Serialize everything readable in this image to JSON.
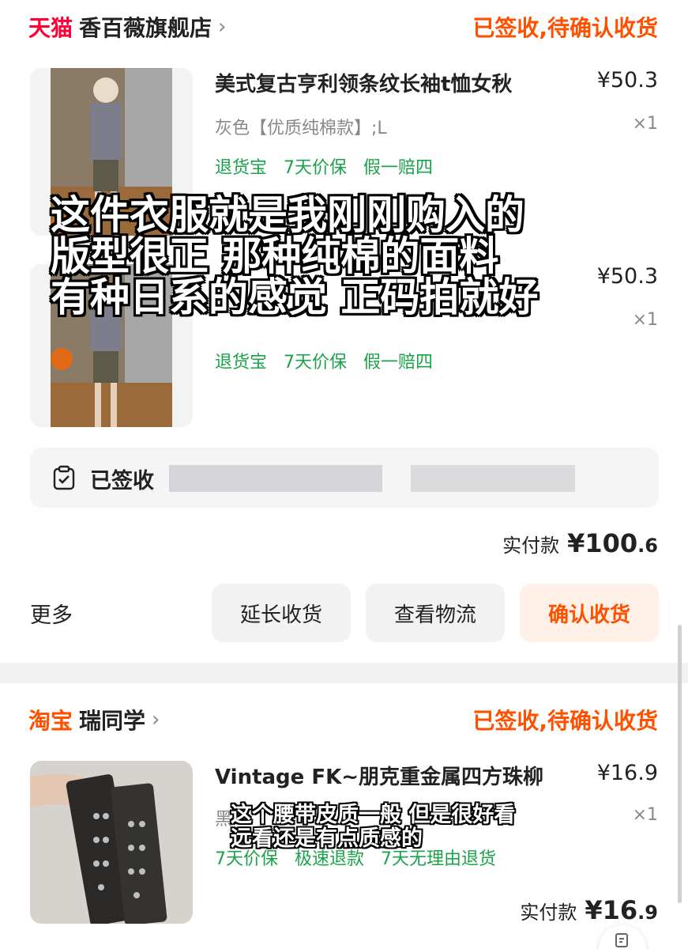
{
  "orders": [
    {
      "platform": "天猫",
      "store": "香百薇旗舰店",
      "status": "已签收,待确认收货",
      "items": [
        {
          "title": "美式复古亨利领条纹长袖t恤女秋",
          "price": "¥50.3",
          "sku": "灰色【优质纯棉款】;L",
          "qty": "×1",
          "tags": [
            "退货宝",
            "7天价保",
            "假一赔四"
          ]
        },
        {
          "title": "",
          "price": "¥50.3",
          "qty": "×1",
          "tags": [
            "退货宝",
            "7天价保",
            "假一赔四"
          ]
        }
      ],
      "logistics": {
        "status": "已签收"
      },
      "payment": {
        "label": "实付款",
        "amount_main": "¥100",
        "amount_decimal": ".6"
      },
      "actions": {
        "more": "更多",
        "extend": "延长收货",
        "logistics": "查看物流",
        "confirm": "确认收货"
      }
    },
    {
      "platform": "淘宝",
      "store": "瑞同学",
      "status": "已签收,待确认收货",
      "items": [
        {
          "title": "Vintage FK~朋克重金属四方珠柳",
          "price": "¥16.9",
          "sku": "黑",
          "qty": "×1",
          "tags": [
            "7天价保",
            "极速退款",
            "7天无理由退货"
          ]
        }
      ],
      "payment": {
        "label": "实付款",
        "amount_main": "¥16",
        "amount_decimal": ".9"
      }
    }
  ],
  "captions": {
    "caption1": [
      "这件衣服就是我刚刚购入的",
      "版型很正 那种纯棉的面料",
      "有种日系的感觉 正码拍就好"
    ],
    "caption2": [
      "这个腰带皮质一般 但是很好看",
      "远看还是有点质感的"
    ]
  },
  "colors": {
    "accent": "#ff5000",
    "tmall": "#ff0036",
    "guarantee": "#1aa34a"
  }
}
